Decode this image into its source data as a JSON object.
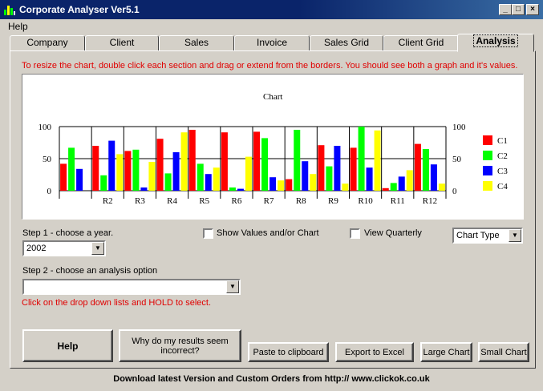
{
  "window": {
    "title": "Corporate Analyser Ver5.1",
    "minimize": "_",
    "maximize": "□",
    "close": "×"
  },
  "menu": {
    "help": "Help"
  },
  "tabs": [
    "Company",
    "Client",
    "Sales",
    "Invoice",
    "Sales Grid",
    "Client Grid",
    "Analysis"
  ],
  "instruction": "To resize the chart, double click each section and drag or extend from the borders. You should see both a graph and it's values.",
  "chart_data": {
    "type": "bar",
    "title": "Chart",
    "categories": [
      "",
      "R2",
      "R3",
      "R4",
      "R5",
      "R6",
      "R7",
      "R8",
      "R9",
      "R10",
      "R11",
      "R12"
    ],
    "series": [
      {
        "name": "C1",
        "color": "#ff0000",
        "values": [
          42,
          70,
          62,
          81,
          95,
          91,
          92,
          18,
          71,
          67,
          4,
          73
        ]
      },
      {
        "name": "C2",
        "color": "#00ff00",
        "values": [
          67,
          24,
          64,
          27,
          42,
          5,
          82,
          95,
          38,
          100,
          12,
          65
        ]
      },
      {
        "name": "C3",
        "color": "#0000ff",
        "values": [
          34,
          78,
          5,
          60,
          26,
          3,
          21,
          46,
          70,
          36,
          22,
          41
        ]
      },
      {
        "name": "C4",
        "color": "#ffff00",
        "values": [
          0,
          57,
          45,
          91,
          36,
          53,
          16,
          26,
          11,
          94,
          32,
          11
        ]
      }
    ],
    "yticks": [
      0,
      50,
      100
    ],
    "ylim": [
      0,
      100
    ],
    "legend": "right"
  },
  "step1": {
    "label": "Step 1 - choose a year.",
    "year": "2002"
  },
  "show_values": {
    "label": "Show Values and/or Chart"
  },
  "view_quarterly": {
    "label": "View Quarterly"
  },
  "chart_type": {
    "value": "Chart Type"
  },
  "step2": {
    "label": "Step 2 - choose an analysis option",
    "value": ""
  },
  "hint": "Click on the drop down lists and HOLD to select.",
  "buttons": {
    "help": "Help",
    "why": "Why do my results seem incorrect?",
    "paste": "Paste to clipboard",
    "export": "Export to Excel",
    "large": "Large Chart",
    "small": "Small Chart"
  },
  "footer": "Download latest Version and Custom Orders from http:// www.clickok.co.uk"
}
